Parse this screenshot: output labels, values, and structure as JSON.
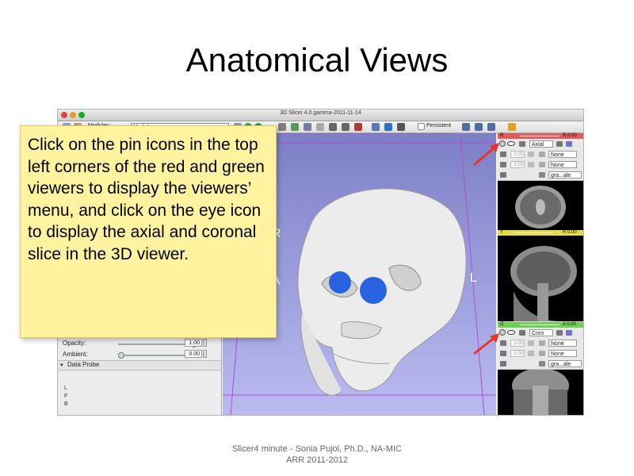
{
  "slide": {
    "title": "Anatomical Views",
    "footer_line1": "Slicer4 minute - Sonia Pujol, Ph.D., NA-MIC",
    "footer_line2": "ARR 2011-2012"
  },
  "window": {
    "title": "3D Slicer 4.0.gamma-2011-11-14",
    "close_color": "#e0443e",
    "minimize_color": "#dea123",
    "zoom_color": "#1aab29"
  },
  "toolbar": {
    "modules_label": "Modules:",
    "module_selected": "Models",
    "persistent_label": "Persistent"
  },
  "left_panel": {
    "opacity_label": "Opacity:",
    "opacity_value": "1.00",
    "ambient_label": "Ambient:",
    "ambient_value": "0.00",
    "data_probe_label": "Data Probe",
    "probe_l": "L",
    "probe_f": "F",
    "probe_b": "B"
  },
  "view3d": {
    "orient_r": "R",
    "orient_a": "A",
    "orient_l": "L"
  },
  "red_viewer": {
    "letter": "R",
    "value": "R 0.00",
    "color": "#e35a5a",
    "orientation": "Axial",
    "opacity1": "1.00",
    "layer1": "None",
    "opacity2": "1.00",
    "layer2": "None",
    "label_layer": "gra...ale"
  },
  "yellow_viewer": {
    "letter": "Y",
    "value": "R 0.00",
    "color": "#e5d94a"
  },
  "green_viewer": {
    "letter": "G",
    "value": "A 0.00",
    "color": "#6fcf53",
    "orientation": "Coro",
    "opacity1": "1.00",
    "layer1": "None",
    "opacity2": "1.00",
    "layer2": "None",
    "label_layer": "gra...ale"
  },
  "callout": {
    "text": "Click on the pin icons in the top left corners of the red and green viewers to display the viewers’ menu, and click on the eye icon to display the axial and coronal slice in the 3D viewer."
  },
  "colors": {
    "callout_bg": "#fff3a0",
    "arrow": "#e8332a",
    "eyeball": "#2a63e0",
    "skull": "#e8e8e8"
  }
}
